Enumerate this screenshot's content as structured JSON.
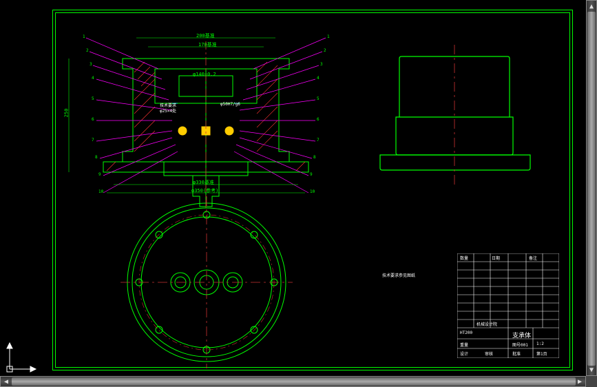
{
  "frame": {
    "outer_color": "#00ff00",
    "inner_color": "#00ff00"
  },
  "dimensions": {
    "top_dim_1": "200基准",
    "top_dim_2": "170基准",
    "inner_dim": "φ140±0.2",
    "bottom_dim_1": "φ330基准",
    "bottom_dim_2": "φ350(参考)",
    "height_dim": "250"
  },
  "leader_numbers": {
    "left": [
      "1",
      "2",
      "3",
      "4",
      "5",
      "6",
      "7",
      "8",
      "9",
      "10"
    ],
    "right": [
      "1",
      "2",
      "3",
      "4",
      "5",
      "6",
      "7",
      "8",
      "9",
      "10"
    ]
  },
  "annotations": {
    "a1": "技术要求",
    "a2": "φ25×4处",
    "a3": "φ50H7/g6"
  },
  "note_text": "技术要求参见图纸",
  "title_block": {
    "part_name": "支承体",
    "material": "HT200",
    "scale": "1:2",
    "drawing_no": "图号001",
    "weight": "重量",
    "sheet": "第1页",
    "designed": "设计",
    "checked": "审核",
    "approved": "批准",
    "date": "日期",
    "company": "机械设计院",
    "qty": "数量",
    "remark": "备注"
  }
}
